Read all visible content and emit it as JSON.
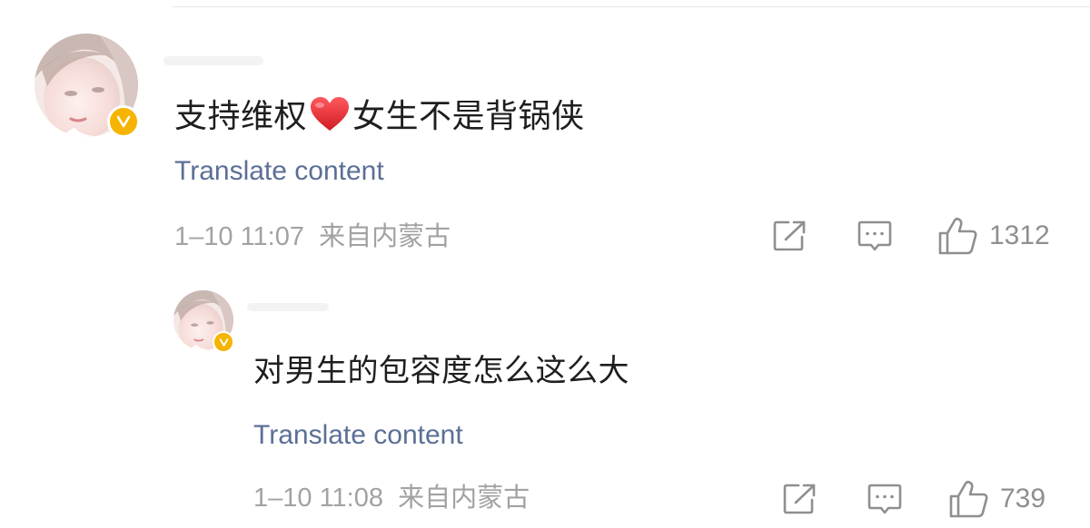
{
  "comment": {
    "text_before_emoji": "支持维权",
    "emoji": "red-heart",
    "text_after_emoji": "女生不是背锅侠",
    "translate_label": "Translate content",
    "timestamp": "1–10 11:07",
    "location": "来自内蒙古",
    "like_count": "1312",
    "verified": true
  },
  "reply": {
    "text": "对男生的包容度怎么这么大",
    "translate_label": "Translate content",
    "timestamp": "1–10 11:08",
    "location": "来自内蒙古",
    "like_count": "739",
    "verified": true
  },
  "colors": {
    "link": "#5b6f96",
    "meta_text": "#a2a2a2",
    "icon": "#8f8f8f",
    "verified_badge": "#f5b400",
    "heart": "#e8252a"
  },
  "icons": {
    "share": "share-icon",
    "reply": "comment-icon",
    "like": "thumbs-up-icon"
  }
}
